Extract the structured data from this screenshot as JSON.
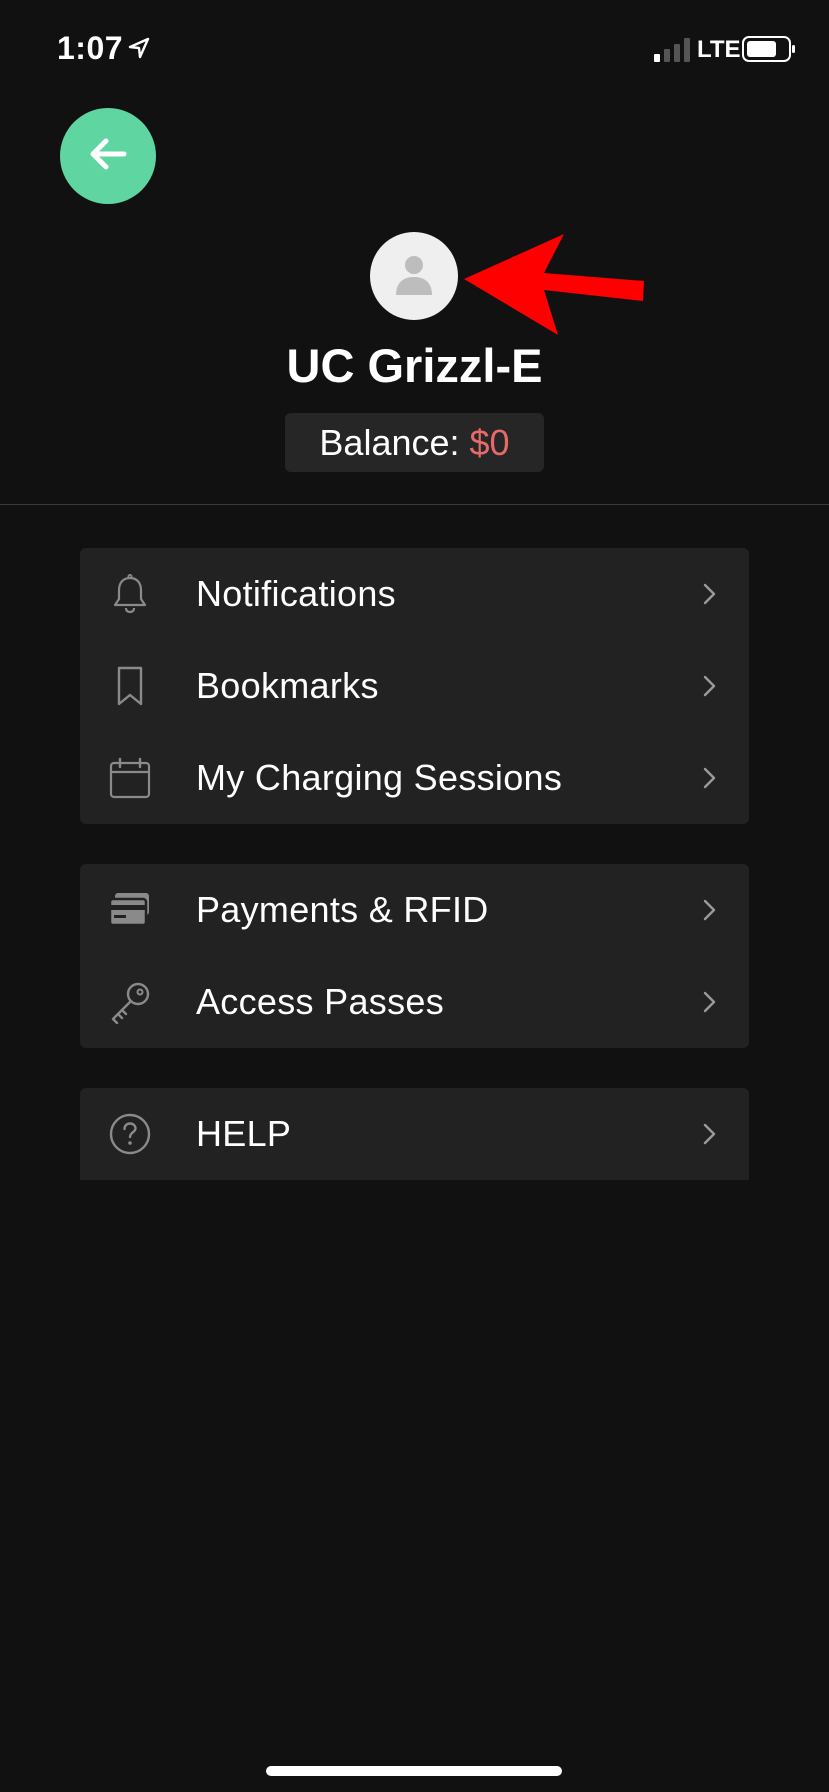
{
  "status_bar": {
    "time": "1:07",
    "network": "LTE",
    "icons": [
      "location-arrow-icon",
      "signal-bars-icon",
      "battery-icon"
    ]
  },
  "header": {
    "back_icon": "arrow-left-icon",
    "avatar_icon": "user-silhouette-icon",
    "annotation": "red-arrow-pointing-to-avatar",
    "name": "UC Grizzl-E",
    "balance_label": "Balance:",
    "balance_amount": "$0"
  },
  "menu_groups": [
    {
      "items": [
        {
          "label": "Notifications",
          "icon": "bell-icon"
        },
        {
          "label": "Bookmarks",
          "icon": "bookmark-icon"
        },
        {
          "label": "My Charging Sessions",
          "icon": "calendar-icon"
        }
      ]
    },
    {
      "items": [
        {
          "label": "Payments & RFID",
          "icon": "credit-card-icon"
        },
        {
          "label": "Access Passes",
          "icon": "key-icon"
        }
      ]
    },
    {
      "items": [
        {
          "label": "HELP",
          "icon": "question-circle-icon"
        }
      ]
    }
  ],
  "colors": {
    "background": "#111111",
    "back_button": "#5fd6a2",
    "card": "#222222",
    "balance_amount": "#e66a6a",
    "icon_gray": "#8a8a8a",
    "annotation_red": "#ff0000"
  }
}
